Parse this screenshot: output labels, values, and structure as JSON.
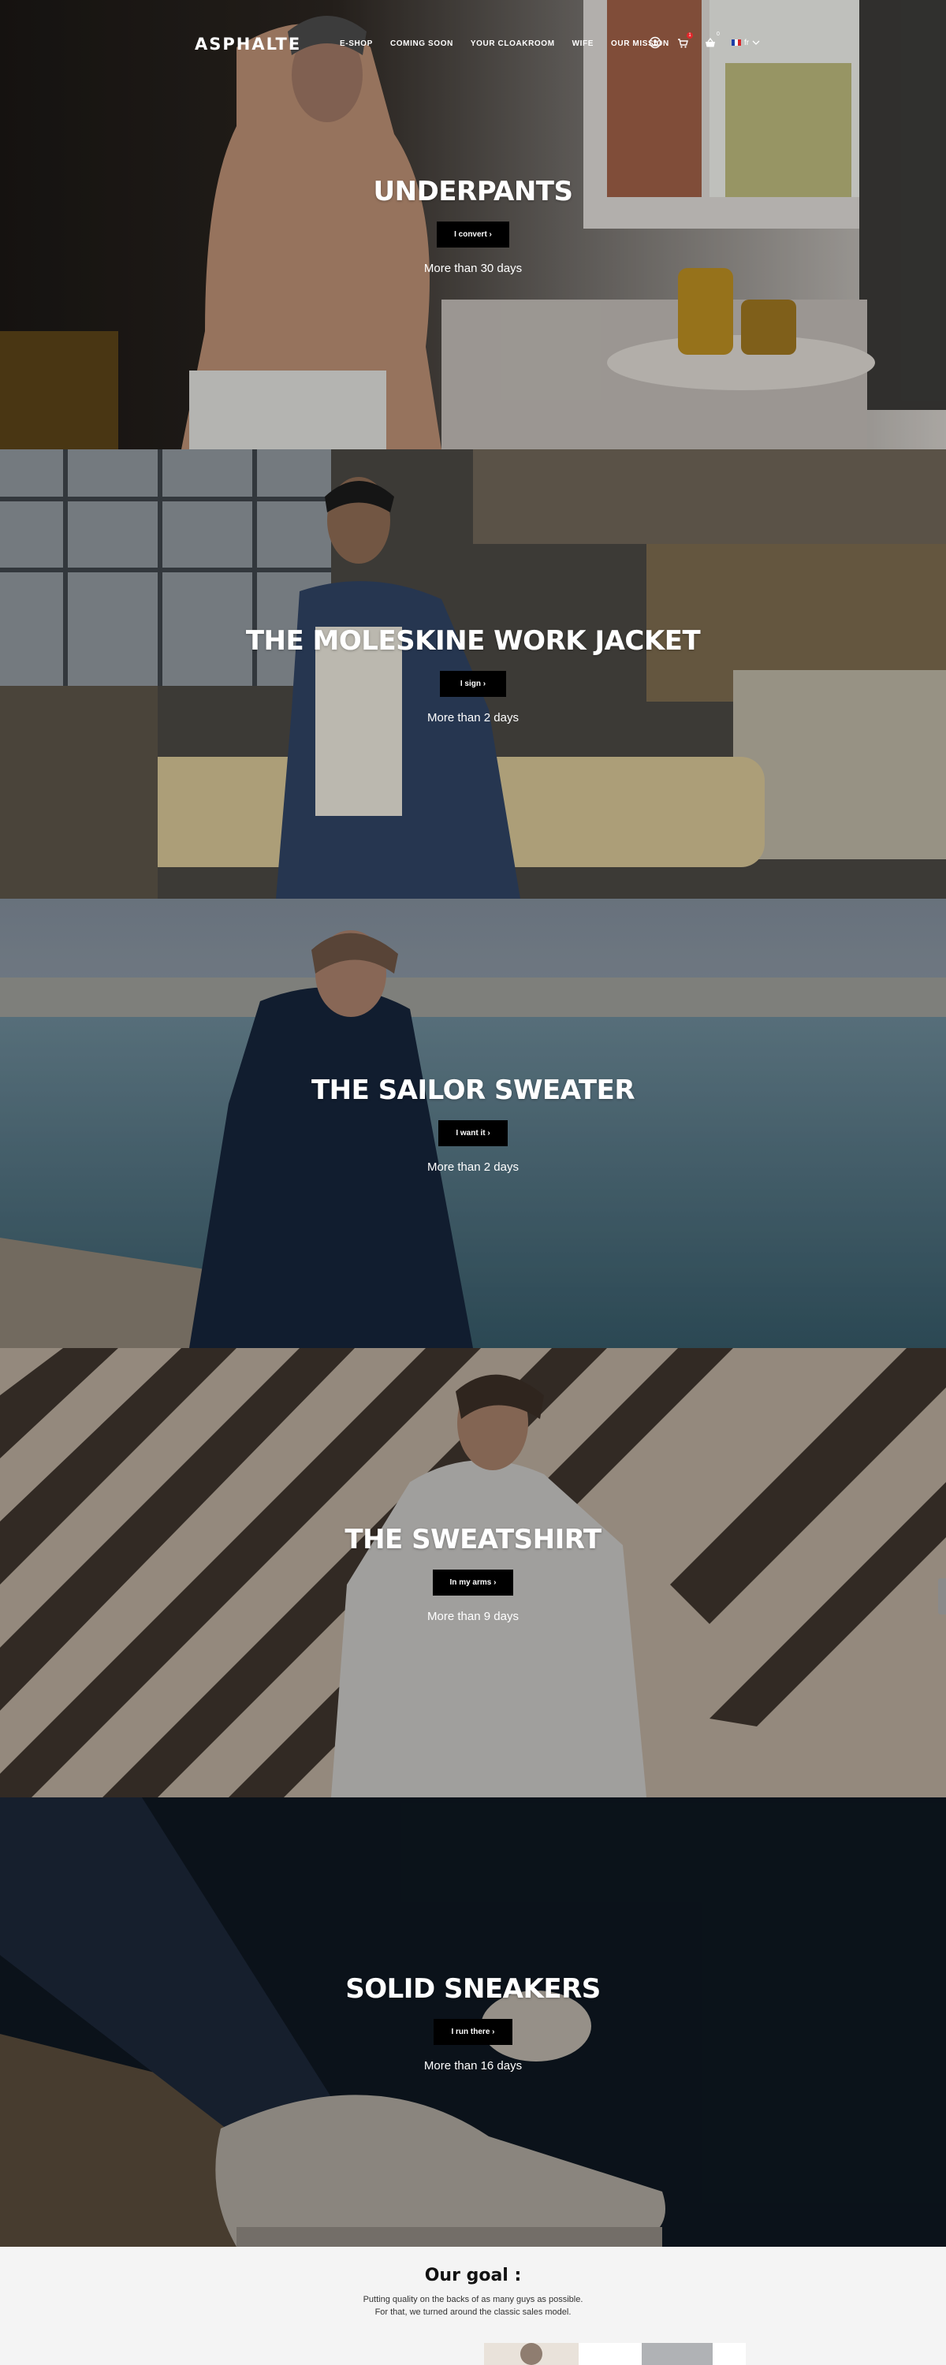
{
  "header": {
    "logo": "ASPHALTE",
    "nav": [
      "E-SHOP",
      "COMING SOON",
      "YOUR CLOAKROOM",
      "WIFE",
      "OUR MISSION"
    ],
    "cart_count": "1",
    "basket_count": "0",
    "language": "fr"
  },
  "sections": [
    {
      "title": "UNDERPANTS",
      "button": "I convert ›",
      "subtitle": "More than 30 days"
    },
    {
      "title": "THE MOLESKINE WORK JACKET",
      "button": "I sign ›",
      "subtitle": "More than 2 days"
    },
    {
      "title": "THE SAILOR SWEATER",
      "button": "I want it ›",
      "subtitle": "More than 2 days"
    },
    {
      "title": "THE SWEATSHIRT",
      "button": "In my arms ›",
      "subtitle": "More than 9 days"
    },
    {
      "title": "SOLID SNEAKERS",
      "button": "I run there ›",
      "subtitle": "More than 16 days"
    }
  ],
  "goal": {
    "title": "Our goal :",
    "line1": "Putting quality on the backs of as many guys as possible.",
    "line2": "For that, we turned around the classic sales model."
  },
  "colors": {
    "button_bg": "#000000",
    "badge": "#e3262a",
    "background": "#f4f4f4"
  },
  "icons": [
    "user-icon",
    "cart-icon",
    "basket-icon",
    "chevron-down-icon"
  ]
}
